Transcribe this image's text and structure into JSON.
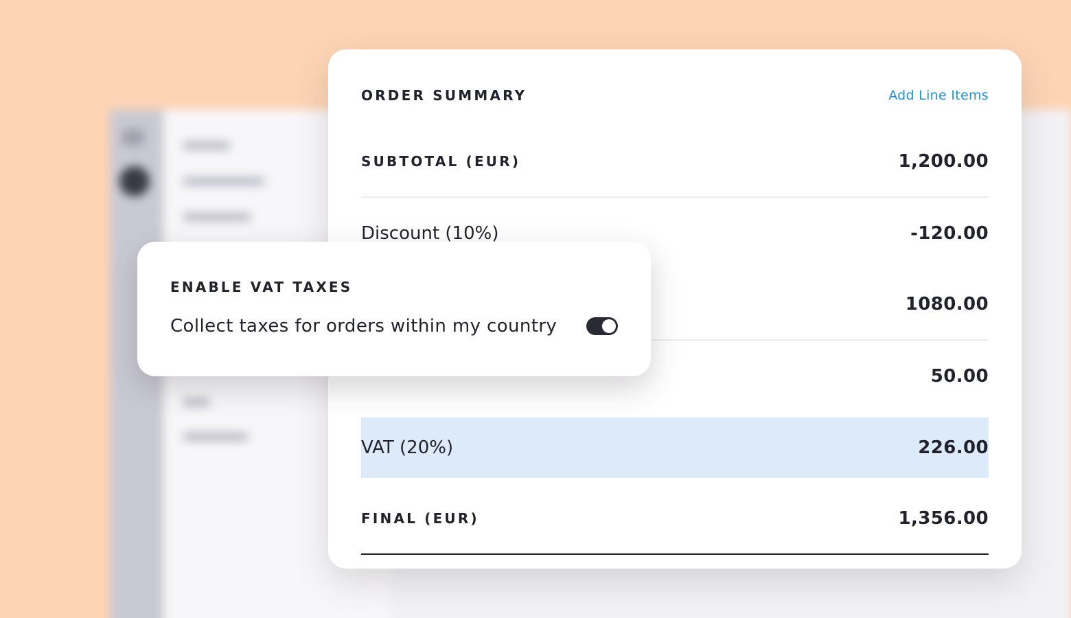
{
  "order_summary": {
    "title": "ORDER SUMMARY",
    "add_link": "Add Line Items",
    "rows": [
      {
        "label": "SUBTOTAL (EUR)",
        "value": "1,200.00"
      },
      {
        "label": "Discount (10%)",
        "value": "-120.00"
      },
      {
        "label": "",
        "value": "1080.00"
      },
      {
        "label": "",
        "value": "50.00"
      },
      {
        "label": "VAT (20%)",
        "value": "226.00"
      },
      {
        "label": "FINAL (EUR)",
        "value": "1,356.00"
      }
    ]
  },
  "vat_popover": {
    "title": "ENABLE VAT TAXES",
    "toggle_label": "Collect taxes for orders within my country",
    "toggle_on": true
  },
  "colors": {
    "background": "#fdd5b5",
    "link": "#1c8fe0",
    "highlight": "#ddeafa",
    "toggle": "#2a2a34"
  }
}
